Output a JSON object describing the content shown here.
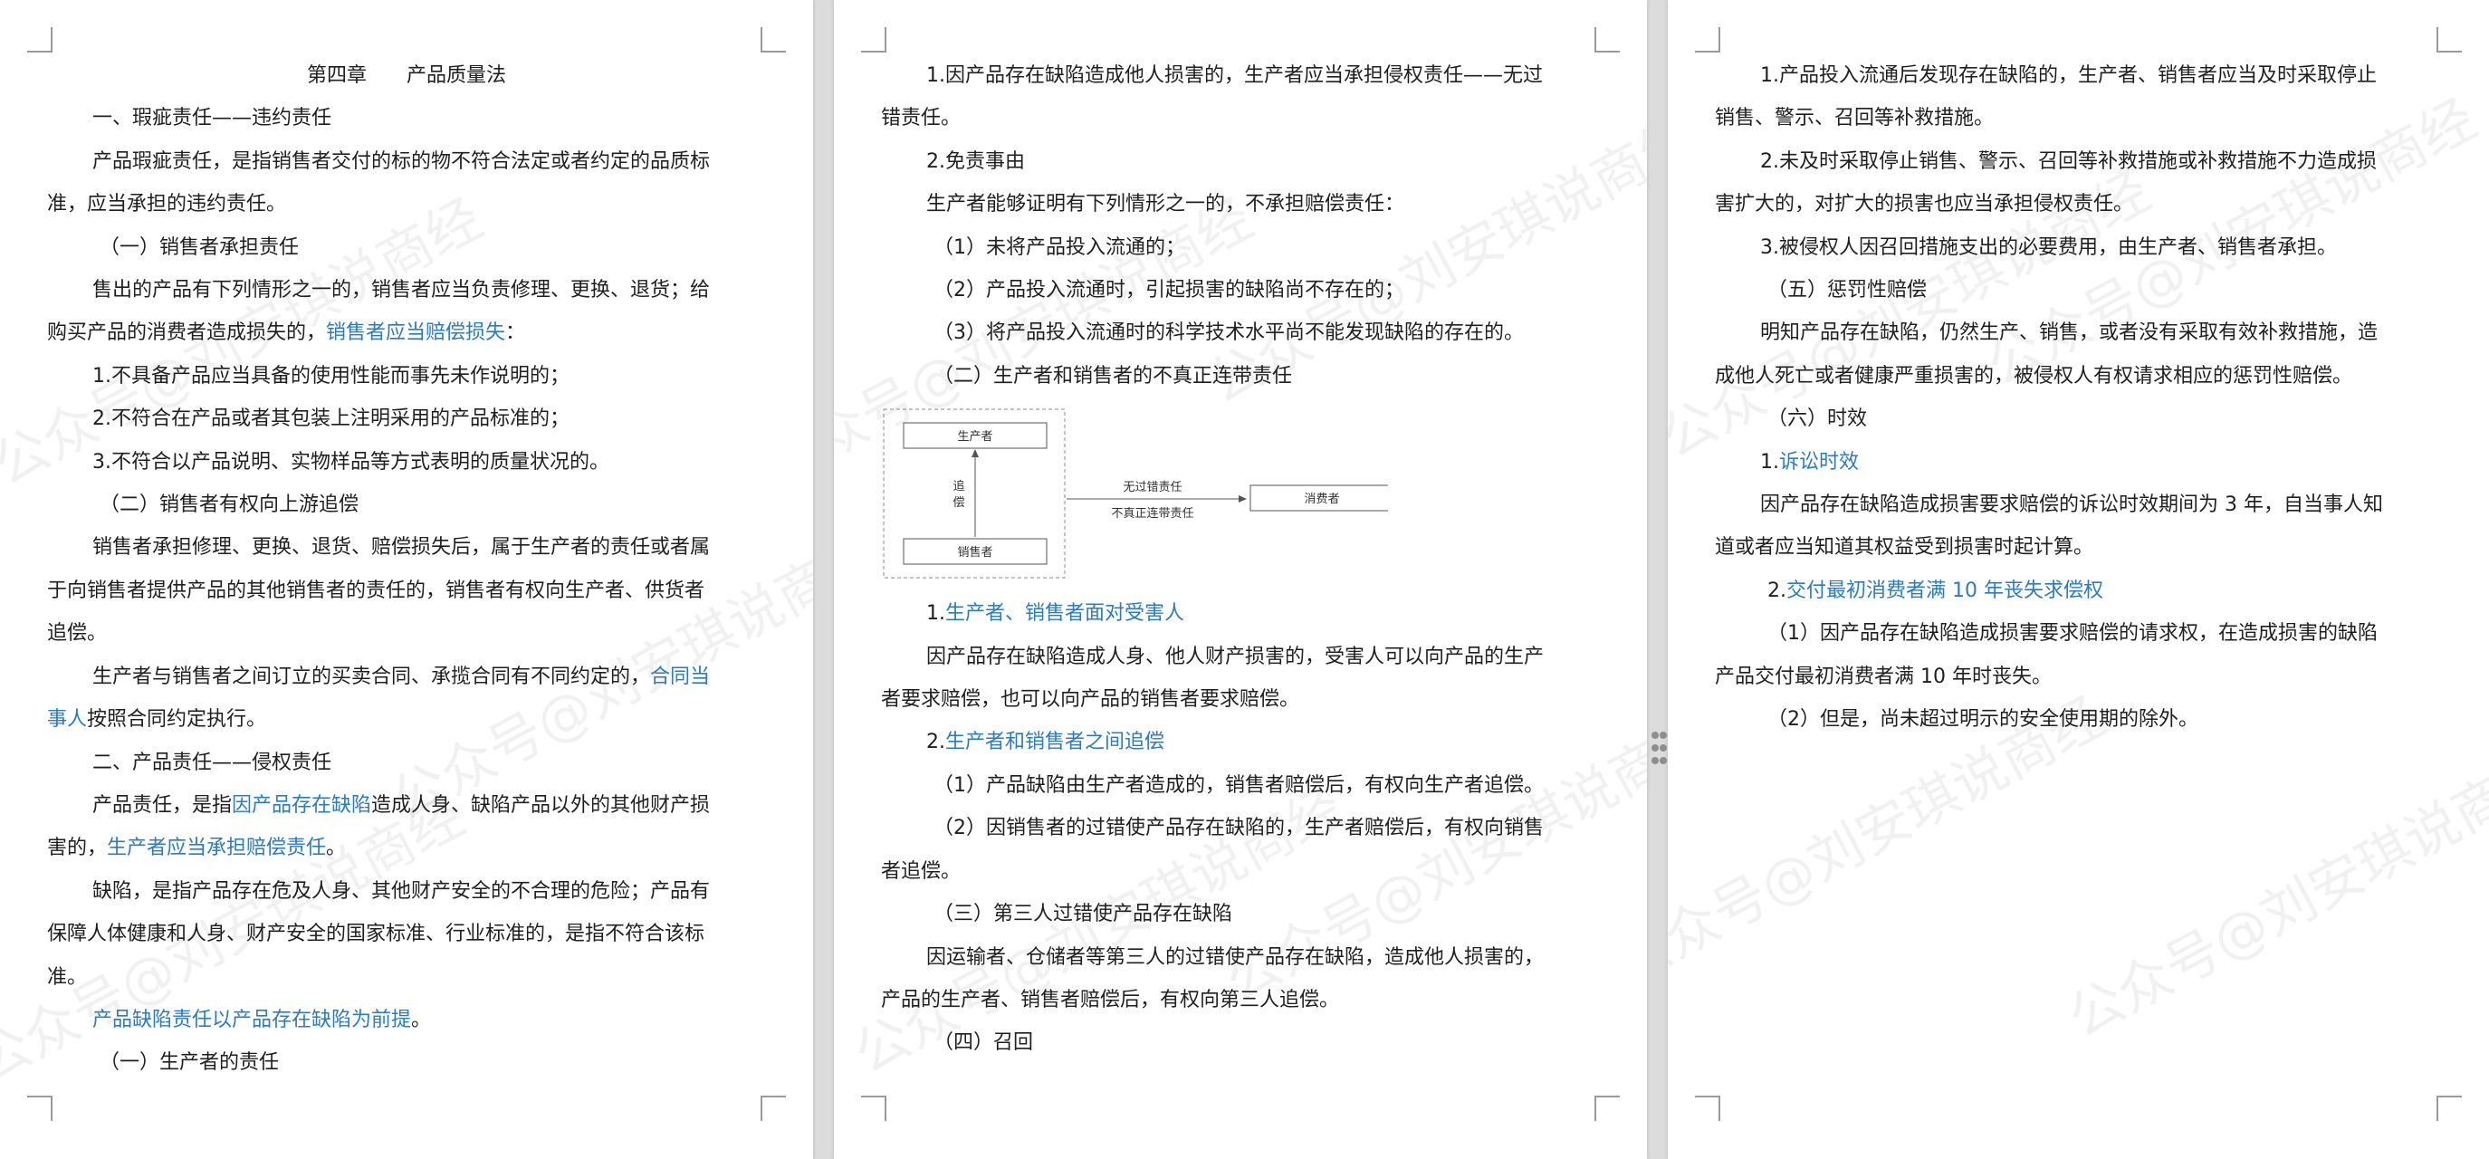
{
  "watermark_text": "公众号@刘安琪说商经",
  "pages": [
    {
      "lines": [
        {
          "parts": [
            {
              "t": "第四章　　产品质量法"
            }
          ],
          "style": "title"
        },
        {
          "parts": [
            {
              "t": "一、瑕疵责任——违约责任"
            }
          ],
          "style": "i1"
        },
        {
          "parts": [
            {
              "t": "产品瑕疵责任，是指销售者交付的标的物不符合法定或者约定的品质标"
            }
          ],
          "style": "i1"
        },
        {
          "parts": [
            {
              "t": "准，应当承担的违约责任。"
            }
          ],
          "style": "i0"
        },
        {
          "parts": [
            {
              "t": "（一）销售者承担责任"
            }
          ],
          "style": "i2"
        },
        {
          "parts": [
            {
              "t": "售出的产品有下列情形之一的，销售者应当负责修理、更换、退货；给"
            }
          ],
          "style": "i1"
        },
        {
          "parts": [
            {
              "t": "购买产品的消费者造成损失的，"
            },
            {
              "t": "销售者应当赔偿损失",
              "link": true
            },
            {
              "t": "："
            }
          ],
          "style": "i0"
        },
        {
          "parts": [
            {
              "t": "1.不具备产品应当具备的使用性能而事先未作说明的；"
            }
          ],
          "style": "i1"
        },
        {
          "parts": [
            {
              "t": "2.不符合在产品或者其包装上注明采用的产品标准的；"
            }
          ],
          "style": "i1"
        },
        {
          "parts": [
            {
              "t": "3.不符合以产品说明、实物样品等方式表明的质量状况的。"
            }
          ],
          "style": "i1"
        },
        {
          "parts": [
            {
              "t": "（二）销售者有权向上游追偿"
            }
          ],
          "style": "i2"
        },
        {
          "parts": [
            {
              "t": "销售者承担修理、更换、退货、赔偿损失后，属于生产者的责任或者属"
            }
          ],
          "style": "i1"
        },
        {
          "parts": [
            {
              "t": "于向销售者提供产品的其他销售者的责任的，销售者有权向生产者、供货者"
            }
          ],
          "style": "i0"
        },
        {
          "parts": [
            {
              "t": "追偿。"
            }
          ],
          "style": "i0"
        },
        {
          "parts": [
            {
              "t": "生产者与销售者之间订立的买卖合同、承揽合同有不同约定的，"
            },
            {
              "t": "合同当",
              "link": true
            }
          ],
          "style": "i1"
        },
        {
          "parts": [
            {
              "t": "事人",
              "link": true
            },
            {
              "t": "按照合同约定执行。"
            }
          ],
          "style": "i0"
        },
        {
          "parts": [
            {
              "t": "二、产品责任——侵权责任"
            }
          ],
          "style": "i1"
        },
        {
          "parts": [
            {
              "t": "产品责任，是指"
            },
            {
              "t": "因产品存在缺陷",
              "link": true
            },
            {
              "t": "造成人身、缺陷产品以外的其他财产损"
            }
          ],
          "style": "i1"
        },
        {
          "parts": [
            {
              "t": "害的，"
            },
            {
              "t": "生产者应当承担赔偿责任",
              "link": true
            },
            {
              "t": "。"
            }
          ],
          "style": "i0"
        },
        {
          "parts": [
            {
              "t": "缺陷，是指产品存在危及人身、其他财产安全的不合理的危险；产品有"
            }
          ],
          "style": "i1"
        },
        {
          "parts": [
            {
              "t": "保障人体健康和人身、财产安全的国家标准、行业标准的，是指不符合该标"
            }
          ],
          "style": "i0"
        },
        {
          "parts": [
            {
              "t": "准。"
            }
          ],
          "style": "i0"
        },
        {
          "parts": [
            {
              "t": "产品缺陷责任以产品存在缺陷为前提",
              "link": true
            },
            {
              "t": "。"
            }
          ],
          "style": "i1"
        },
        {
          "parts": [
            {
              "t": "（一）生产者的责任"
            }
          ],
          "style": "i2"
        }
      ]
    },
    {
      "lines": [
        {
          "parts": [
            {
              "t": "1.因产品存在缺陷造成他人损害的，生产者应当承担侵权责任——无过"
            }
          ],
          "style": "i1"
        },
        {
          "parts": [
            {
              "t": "错责任。"
            }
          ],
          "style": "i0"
        },
        {
          "parts": [
            {
              "t": "2.免责事由"
            }
          ],
          "style": "i1"
        },
        {
          "parts": [
            {
              "t": "生产者能够证明有下列情形之一的，不承担赔偿责任："
            }
          ],
          "style": "i1"
        },
        {
          "parts": [
            {
              "t": "（1）未将产品投入流通的；"
            }
          ],
          "style": "i2"
        },
        {
          "parts": [
            {
              "t": "（2）产品投入流通时，引起损害的缺陷尚不存在的；"
            }
          ],
          "style": "i2"
        },
        {
          "parts": [
            {
              "t": "（3）将产品投入流通时的科学技术水平尚不能发现缺陷的存在的。"
            }
          ],
          "style": "i2"
        },
        {
          "parts": [
            {
              "t": "（二）生产者和销售者的不真正连带责任"
            }
          ],
          "style": "i2"
        },
        {
          "diagram": true
        },
        {
          "parts": [
            {
              "t": "1."
            },
            {
              "t": "生产者、销售者面对受害人",
              "link": true
            }
          ],
          "style": "i1"
        },
        {
          "parts": [
            {
              "t": "因产品存在缺陷造成人身、他人财产损害的，受害人可以向产品的生产"
            }
          ],
          "style": "i1"
        },
        {
          "parts": [
            {
              "t": "者要求赔偿，也可以向产品的销售者要求赔偿。"
            }
          ],
          "style": "i0"
        },
        {
          "parts": [
            {
              "t": "2."
            },
            {
              "t": "生产者和销售者之间追偿",
              "link": true
            }
          ],
          "style": "i1"
        },
        {
          "parts": [
            {
              "t": "（1）产品缺陷由生产者造成的，销售者赔偿后，有权向生产者追偿。"
            }
          ],
          "style": "i2"
        },
        {
          "parts": [
            {
              "t": "（2）因销售者的过错使产品存在缺陷的，生产者赔偿后，有权向销售"
            }
          ],
          "style": "i2"
        },
        {
          "parts": [
            {
              "t": "者追偿。"
            }
          ],
          "style": "i0"
        },
        {
          "parts": [
            {
              "t": "（三）第三人过错使产品存在缺陷"
            }
          ],
          "style": "i2"
        },
        {
          "parts": [
            {
              "t": "因运输者、仓储者等第三人的过错使产品存在缺陷，造成他人损害的，"
            }
          ],
          "style": "i1"
        },
        {
          "parts": [
            {
              "t": "产品的生产者、销售者赔偿后，有权向第三人追偿。"
            }
          ],
          "style": "i0"
        },
        {
          "parts": [
            {
              "t": "（四）召回"
            }
          ],
          "style": "i2"
        }
      ],
      "diagram": {
        "producer": "生产者",
        "seller": "销售者",
        "recourse": "追偿",
        "arrow_top": "无过错责任",
        "arrow_bottom": "不真正连带责任",
        "consumer": "消费者"
      }
    },
    {
      "lines": [
        {
          "parts": [
            {
              "t": "1.产品投入流通后发现存在缺陷的，生产者、销售者应当及时采取停止"
            }
          ],
          "style": "i1"
        },
        {
          "parts": [
            {
              "t": "销售、警示、召回等补救措施。"
            }
          ],
          "style": "i0"
        },
        {
          "parts": [
            {
              "t": "2.未及时采取停止销售、警示、召回等补救措施或补救措施不力造成损"
            }
          ],
          "style": "i1"
        },
        {
          "parts": [
            {
              "t": "害扩大的，对扩大的损害也应当承担侵权责任。"
            }
          ],
          "style": "i0"
        },
        {
          "parts": [
            {
              "t": "3.被侵权人因召回措施支出的必要费用，由生产者、销售者承担。"
            }
          ],
          "style": "i1"
        },
        {
          "parts": [
            {
              "t": "（五）惩罚性赔偿"
            }
          ],
          "style": "i2"
        },
        {
          "parts": [
            {
              "t": "明知产品存在缺陷，仍然生产、销售，或者没有采取有效补救措施，造"
            }
          ],
          "style": "i1"
        },
        {
          "parts": [
            {
              "t": "成他人死亡或者健康严重损害的，被侵权人有权请求相应的惩罚性赔偿。"
            }
          ],
          "style": "i0"
        },
        {
          "parts": [
            {
              "t": "（六）时效"
            }
          ],
          "style": "i2"
        },
        {
          "parts": [
            {
              "t": "1."
            },
            {
              "t": "诉讼时效",
              "link": true
            }
          ],
          "style": "i1"
        },
        {
          "parts": [
            {
              "t": "因产品存在缺陷造成损害要求赔偿的诉讼时效期间为 3 年，自当事人知"
            }
          ],
          "style": "i1"
        },
        {
          "parts": [
            {
              "t": "道或者应当知道其权益受到损害时起计算。"
            }
          ],
          "style": "i0"
        },
        {
          "parts": [
            {
              "t": "2."
            },
            {
              "t": "交付最初消费者满 10 年丧失求偿权",
              "link": true
            }
          ],
          "style": "i2"
        },
        {
          "parts": [
            {
              "t": "（1）因产品存在缺陷造成损害要求赔偿的请求权，在造成损害的缺陷"
            }
          ],
          "style": "i2"
        },
        {
          "parts": [
            {
              "t": "产品交付最初消费者满 10 年时丧失。"
            }
          ],
          "style": "i0"
        },
        {
          "parts": [
            {
              "t": "（2）但是，尚未超过明示的安全使用期的除外。"
            }
          ],
          "style": "i2"
        }
      ]
    }
  ]
}
